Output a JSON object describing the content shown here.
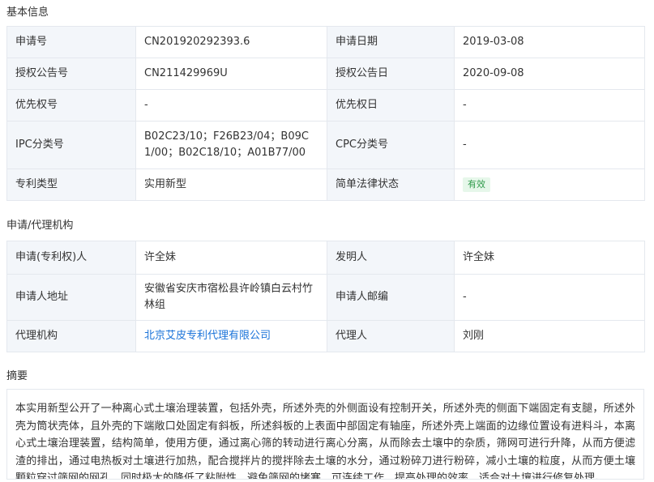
{
  "basic_info": {
    "title": "基本信息",
    "rows": [
      [
        "申请号",
        "CN201920292393.6",
        "申请日期",
        "2019-03-08"
      ],
      [
        "授权公告号",
        "CN211429969U",
        "授权公告日",
        "2020-09-08"
      ],
      [
        "优先权号",
        "-",
        "优先权日",
        "-"
      ],
      [
        "IPC分类号",
        "B02C23/10；F26B23/04；B09C1/00；B02C18/10；A01B77/00",
        "CPC分类号",
        "-"
      ],
      [
        "专利类型",
        "实用新型",
        "简单法律状态",
        "有效"
      ]
    ]
  },
  "agency_info": {
    "title": "申请/代理机构",
    "rows": [
      [
        "申请(专利权)人",
        "许全妹",
        "发明人",
        "许全妹"
      ],
      [
        "申请人地址",
        "安徽省安庆市宿松县许岭镇白云村竹林组",
        "申请人邮编",
        "-"
      ],
      [
        "代理机构",
        "北京艾皮专利代理有限公司",
        "代理人",
        "刘刚"
      ]
    ]
  },
  "abstract": {
    "title": "摘要",
    "text": "本实用新型公开了一种离心式土壤治理装置，包括外壳，所述外壳的外侧面设有控制开关，所述外壳的侧面下端固定有支腿，所述外壳为筒状壳体，且外壳的下端敞口处固定有斜板，所述斜板的上表面中部固定有轴座，所述外壳上端面的边缘位置设有进料斗，本离心式土壤治理装置，结构简单，使用方便，通过离心筛的转动进行离心分离，从而除去土壤中的杂质，筛网可进行升降，从而方便滤渣的排出，通过电热板对土壤进行加热，配合搅拌片的搅拌除去土壤的水分，通过粉碎刀进行粉碎，减小土壤的粒度，从而方便土壤颗粒穿过筛网的网孔，同时极大的降低了粘附性，避免筛网的堵塞，可连续工作，提高处理的效率，适合对土壤进行修复处理。"
  },
  "colors": {
    "label_bg": "#f3f6fa",
    "border": "#e4e8ee",
    "link": "#1a73d9",
    "badge_bg": "#e6f7ea",
    "badge_text": "#2e9a4a"
  }
}
